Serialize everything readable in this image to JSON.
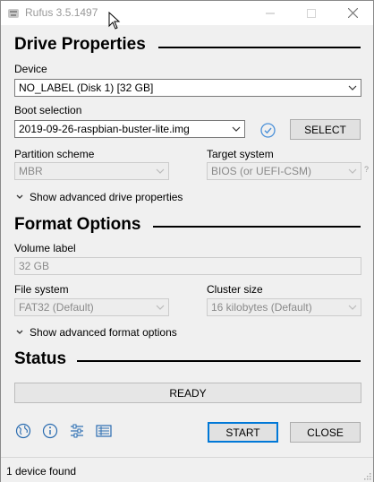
{
  "window": {
    "title": "Rufus 3.5.1497"
  },
  "drive_properties": {
    "heading": "Drive Properties",
    "device_label": "Device",
    "device_value": "NO_LABEL (Disk 1) [32 GB]",
    "boot_label": "Boot selection",
    "boot_value": "2019-09-26-raspbian-buster-lite.img",
    "select_button": "SELECT",
    "partition_label": "Partition scheme",
    "partition_value": "MBR",
    "target_label": "Target system",
    "target_value": "BIOS (or UEFI-CSM)",
    "help_mark": "?",
    "advanced_toggle": "Show advanced drive properties"
  },
  "format_options": {
    "heading": "Format Options",
    "volume_label": "Volume label",
    "volume_value": "32 GB",
    "fs_label": "File system",
    "fs_value": "FAT32 (Default)",
    "cluster_label": "Cluster size",
    "cluster_value": "16 kilobytes (Default)",
    "advanced_toggle": "Show advanced format options"
  },
  "status": {
    "heading": "Status",
    "progress_text": "READY",
    "progress_fraction": 0
  },
  "toolbar": {
    "icons": [
      "globe-icon",
      "info-icon",
      "settings-sliders-icon",
      "log-icon"
    ],
    "start_label": "START",
    "close_label": "CLOSE"
  },
  "statusbar": {
    "text": "1 device found"
  },
  "colors": {
    "check_icon": "#4a90d9",
    "default_button_border": "#0078d7",
    "toolbar_icons": "#2a6cb0"
  }
}
